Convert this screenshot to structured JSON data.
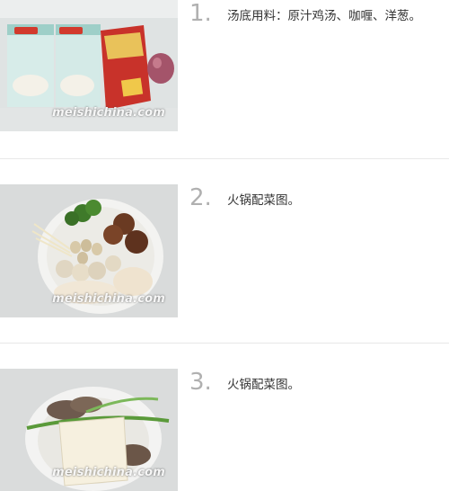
{
  "steps": [
    {
      "number": "1.",
      "text": "汤底用料：原汁鸡汤、咖喱、洋葱。",
      "watermark": "meishichina.com"
    },
    {
      "number": "2.",
      "text": "火锅配菜图。",
      "watermark": "meishichina.com"
    },
    {
      "number": "3.",
      "text": "火锅配菜图。",
      "watermark": "meishichina.com"
    }
  ]
}
